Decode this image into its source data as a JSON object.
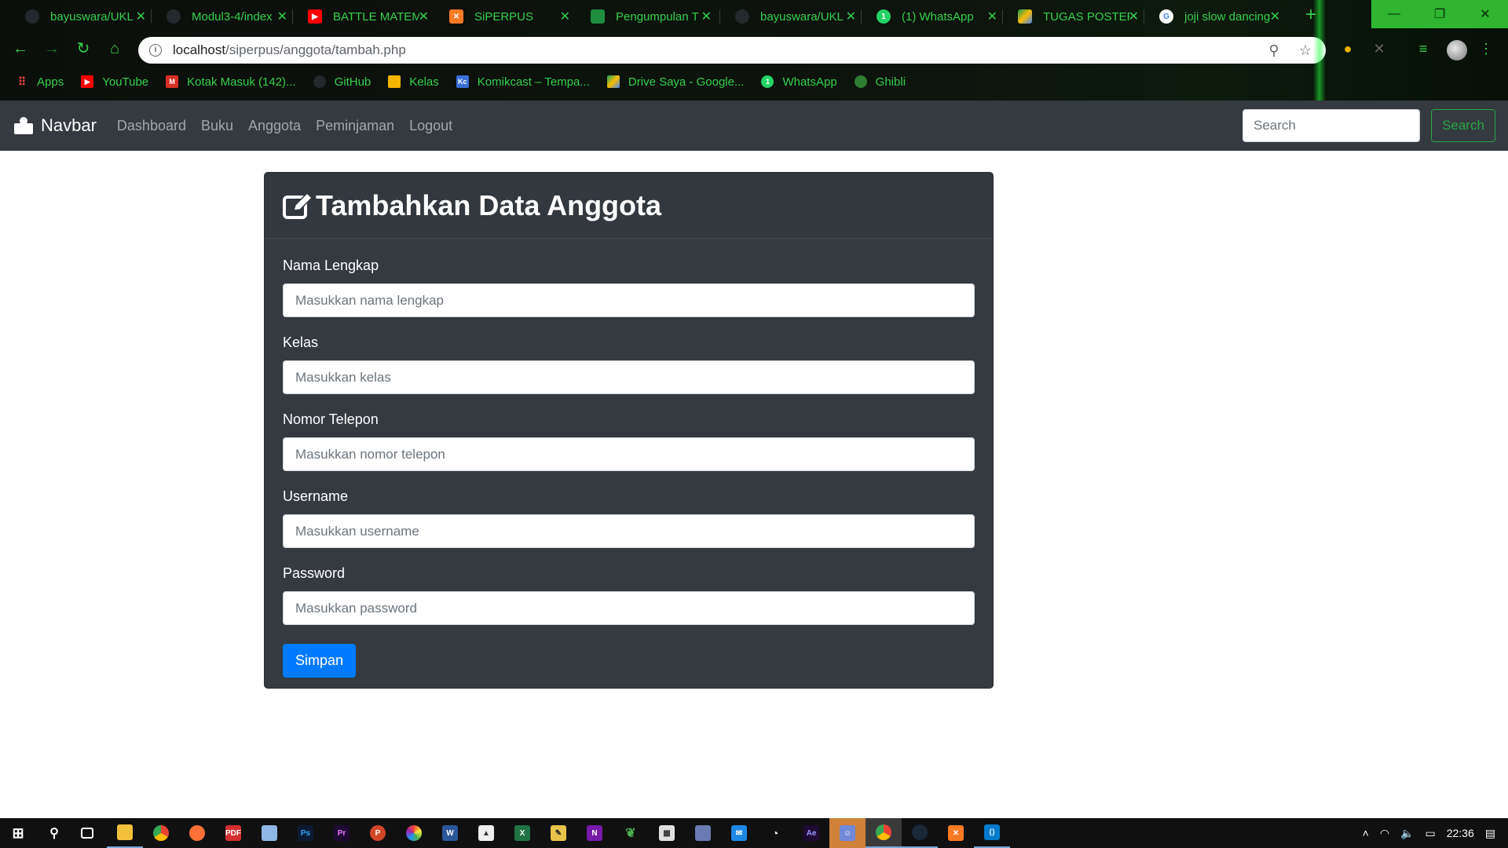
{
  "browser": {
    "tabs": [
      {
        "title": "bayuswara/UKL",
        "icon": "github-icon",
        "color": "#24292e"
      },
      {
        "title": "Modul3-4/index",
        "icon": "github-icon",
        "color": "#24292e"
      },
      {
        "title": "BATTLE MATEMATIKA",
        "icon": "youtube-icon",
        "color": "#ff0000"
      },
      {
        "title": "SiPERPUS",
        "icon": "xampp-icon",
        "color": "#fb7a24"
      },
      {
        "title": "Pengumpulan T",
        "icon": "classroom-icon",
        "color": "#1e8e3e"
      },
      {
        "title": "bayuswara/UKL",
        "icon": "github-icon",
        "color": "#24292e"
      },
      {
        "title": "(1) WhatsApp",
        "icon": "whatsapp-icon",
        "color": "#25d366"
      },
      {
        "title": "TUGAS POSTER",
        "icon": "drive-icon",
        "color": "#fbbc04"
      },
      {
        "title": "joji slow dancing",
        "icon": "google-icon",
        "color": "#ffffff"
      }
    ],
    "url_host": "localhost",
    "url_path": "/siperpus/anggota/tambah.php",
    "bookmarks": [
      {
        "label": "Apps",
        "icon": "apps-grid-icon",
        "color": "#e8453c"
      },
      {
        "label": "YouTube",
        "icon": "youtube-icon",
        "color": "#ff0000"
      },
      {
        "label": "Kotak Masuk (142)...",
        "icon": "gmail-icon",
        "color": "#d93025"
      },
      {
        "label": "GitHub",
        "icon": "github-icon",
        "color": "#24292e"
      },
      {
        "label": "Kelas",
        "icon": "classroom-icon",
        "color": "#f4b400"
      },
      {
        "label": "Komikcast – Tempa...",
        "icon": "komikcast-icon",
        "color": "#3a6fd8"
      },
      {
        "label": "Drive Saya - Google...",
        "icon": "drive-icon",
        "color": "#0f9d58"
      },
      {
        "label": "WhatsApp",
        "icon": "whatsapp-icon",
        "color": "#25d366"
      },
      {
        "label": "Ghibli",
        "icon": "globe-icon",
        "color": "#2e7d32"
      }
    ]
  },
  "navbar": {
    "brand": "Navbar",
    "links": [
      "Dashboard",
      "Buku",
      "Anggota",
      "Peminjaman",
      "Logout"
    ],
    "search_placeholder": "Search",
    "search_button": "Search"
  },
  "form": {
    "title": "Tambahkan Data Anggota",
    "fields": [
      {
        "label": "Nama Lengkap",
        "placeholder": "Masukkan nama lengkap"
      },
      {
        "label": "Kelas",
        "placeholder": "Masukkan kelas"
      },
      {
        "label": "Nomor Telepon",
        "placeholder": "Masukkan nomor telepon"
      },
      {
        "label": "Username",
        "placeholder": "Masukkan username"
      },
      {
        "label": "Password",
        "placeholder": "Masukkan password"
      }
    ],
    "submit_label": "Simpan"
  },
  "taskbar": {
    "clock": "22:36"
  },
  "colors": {
    "accent_green": "#35d04a",
    "navbar_bg": "#343a40",
    "primary_blue": "#007bff",
    "success_green": "#28a745"
  }
}
